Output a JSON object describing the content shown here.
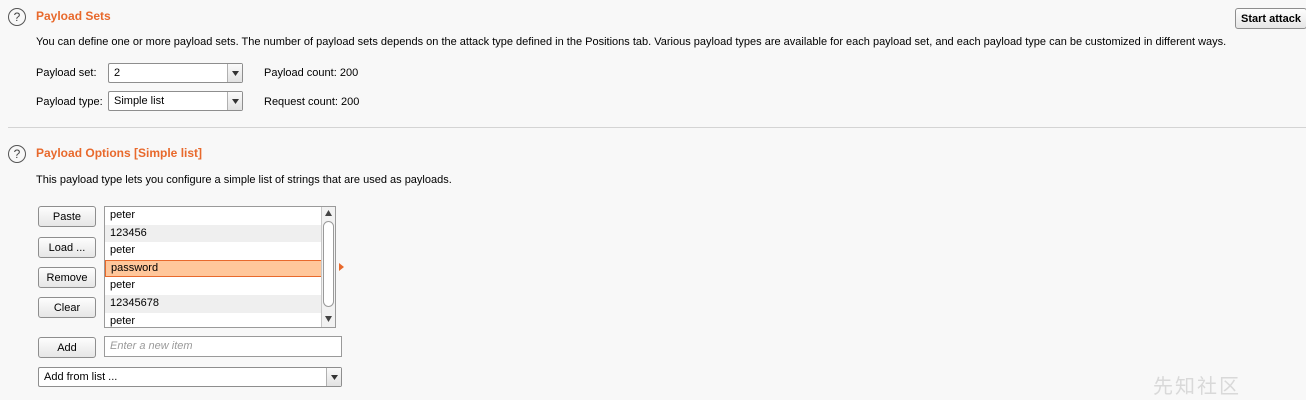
{
  "payload_sets": {
    "title": "Payload Sets",
    "description": "You can define one or more payload sets. The number of payload sets depends on the attack type defined in the Positions tab. Various payload types are available for each payload set, and each payload type can be customized in different ways.",
    "start_attack_label": "Start attack",
    "payload_set_label": "Payload set:",
    "payload_set_value": "2",
    "payload_type_label": "Payload type:",
    "payload_type_value": "Simple list",
    "payload_count": "Payload count: 200",
    "request_count": "Request count: 200"
  },
  "payload_options": {
    "title": "Payload Options [Simple list]",
    "description": "This payload type lets you configure a simple list of strings that are used as payloads.",
    "buttons": {
      "paste": "Paste",
      "load": "Load ...",
      "remove": "Remove",
      "clear": "Clear",
      "add": "Add"
    },
    "list_items": [
      "peter",
      "123456",
      "peter",
      "password",
      "peter",
      "12345678",
      "peter"
    ],
    "selected_index": 3,
    "new_item_placeholder": "Enter a new item",
    "add_from_list_label": "Add from list ..."
  },
  "icons": {
    "help": "question-circle-icon",
    "dropdown": "chevron-down-icon",
    "scroll_up": "arrow-up-icon",
    "scroll_down": "arrow-down-icon",
    "selection_marker": "arrow-right-icon"
  },
  "colors": {
    "accent": "#e8692c",
    "selected_row": "#ffc79b",
    "background": "#f8f8f8"
  },
  "watermark": "先知社区"
}
